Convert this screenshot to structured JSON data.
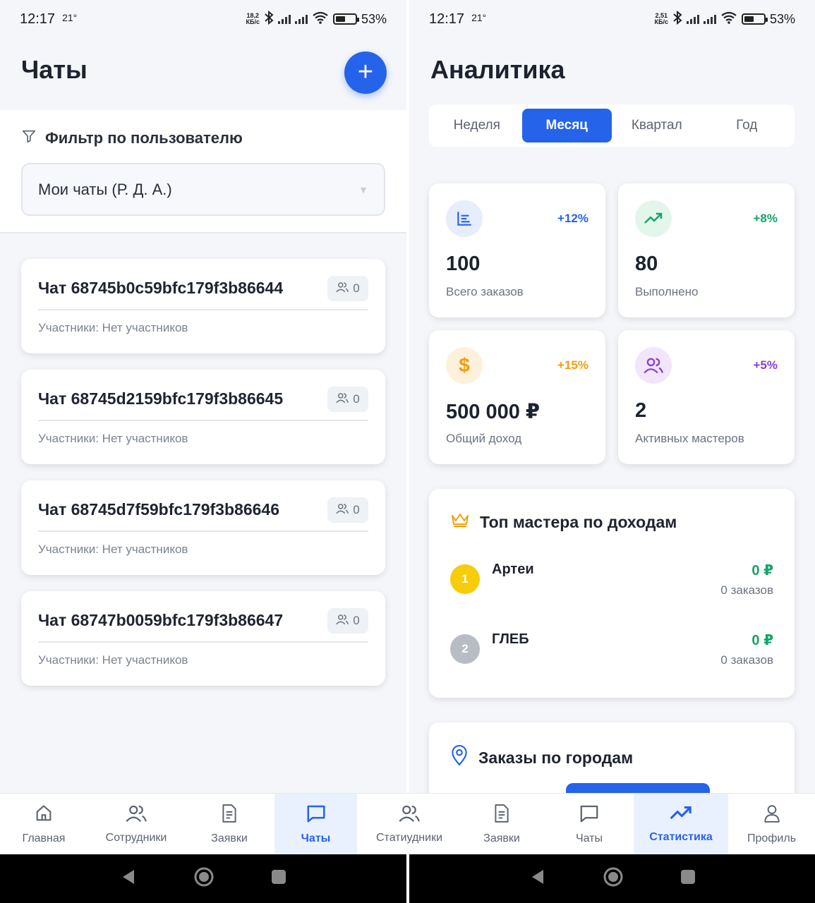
{
  "left_status": {
    "time": "12:17",
    "temp": "21°",
    "speed_top": "18,2",
    "speed_bottom": "КБ/с",
    "battery": "53%"
  },
  "right_status": {
    "time": "12:17",
    "temp": "21°",
    "speed_top": "2,51",
    "speed_bottom": "КБ/с",
    "battery": "53%"
  },
  "chats_page": {
    "title": "Чаты",
    "add_label": "+",
    "filter_title": "Фильтр по пользователю",
    "filter_value": "Мои чаты (Р. Д. А.)",
    "chats": [
      {
        "name": "Чат 68745b0c59bfc179f3b86644",
        "count": "0",
        "members": "Участники: Нет участников"
      },
      {
        "name": "Чат 68745d2159bfc179f3b86645",
        "count": "0",
        "members": "Участники: Нет участников"
      },
      {
        "name": "Чат 68745d7f59bfc179f3b86646",
        "count": "0",
        "members": "Участники: Нет участников"
      },
      {
        "name": "Чат 68747b0059bfc179f3b86647",
        "count": "0",
        "members": "Участники: Нет участников"
      }
    ]
  },
  "analytics_page": {
    "title": "Аналитика",
    "periods": [
      "Неделя",
      "Месяц",
      "Квартал",
      "Год"
    ],
    "active_period": "Месяц",
    "stats": [
      {
        "value": "100",
        "label": "Всего заказов",
        "delta": "+12%",
        "icon": "bar-chart-icon",
        "color": "#2563eb",
        "bg": "#e6edfc"
      },
      {
        "value": "80",
        "label": "Выполнено",
        "delta": "+8%",
        "icon": "trending-up-icon",
        "color": "#16a36a",
        "bg": "#e2f6ec"
      },
      {
        "value": "500 000 ₽",
        "label": "Общий доход",
        "delta": "+15%",
        "icon": "dollar-icon",
        "color": "#f29d0c",
        "bg": "#fdf1dc"
      },
      {
        "value": "2",
        "label": "Активных мастеров",
        "delta": "+5%",
        "icon": "users-icon",
        "color": "#8b3fd9",
        "bg": "#f1e6fb"
      }
    ],
    "top_masters_title": "Топ мастера по доходам",
    "top_masters": [
      {
        "rank": "1",
        "name": "Артеи",
        "income": "0 ₽",
        "orders": "0 заказов",
        "color": "#f7cc08"
      },
      {
        "rank": "2",
        "name": "ГЛЕБ",
        "income": "0 ₽",
        "orders": "0 заказов",
        "color": "#b8bcc4"
      }
    ],
    "cities_title": "Заказы по городам"
  },
  "nav": {
    "left": [
      {
        "label": "Главная",
        "icon": "home-icon"
      },
      {
        "label": "Сотрудники",
        "icon": "users-icon"
      },
      {
        "label": "Заявки",
        "icon": "document-icon"
      },
      {
        "label": "Чаты",
        "icon": "chat-icon",
        "active": true
      }
    ],
    "right": [
      {
        "label": "Стати​удники",
        "icon": "users-icon"
      },
      {
        "label": "Заявки",
        "icon": "document-icon"
      },
      {
        "label": "Чаты",
        "icon": "chat-icon"
      },
      {
        "label": "Статистика",
        "icon": "trending-up-icon",
        "active": true
      },
      {
        "label": "Профиль",
        "icon": "profile-icon"
      }
    ]
  },
  "colors": {
    "accent": "#2563eb",
    "background": "#f4f6f9",
    "success": "#16a36a"
  }
}
